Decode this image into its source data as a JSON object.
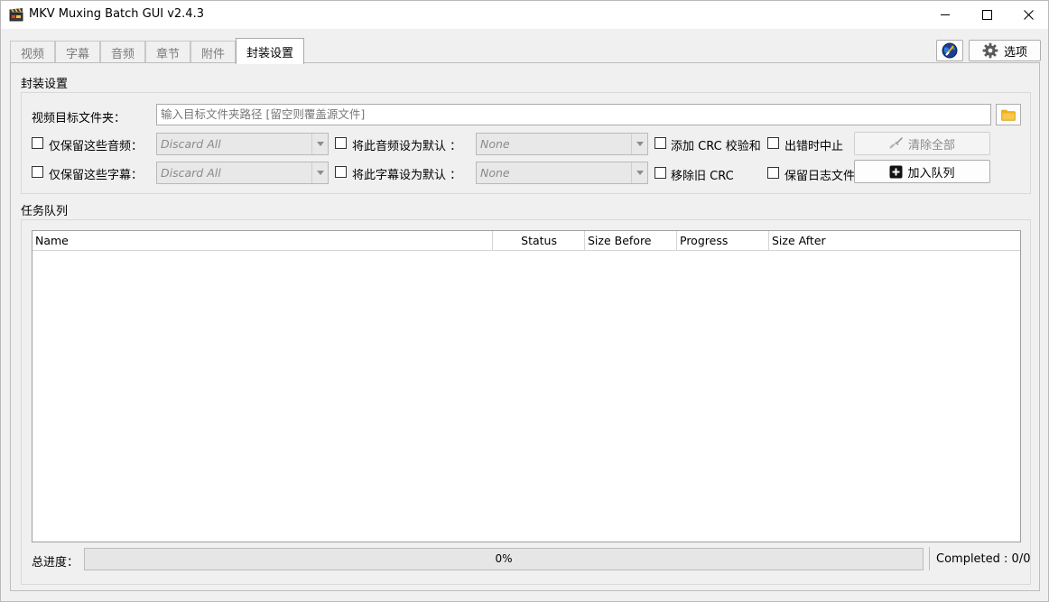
{
  "window": {
    "title": "MKV Muxing Batch GUI v2.4.3"
  },
  "tabs": [
    {
      "label": "视频"
    },
    {
      "label": "字幕"
    },
    {
      "label": "音频"
    },
    {
      "label": "章节"
    },
    {
      "label": "附件"
    },
    {
      "label": "封装设置"
    }
  ],
  "active_tab": 5,
  "toolbar": {
    "options_label": "选项"
  },
  "mux_settings": {
    "section_title": "封装设置",
    "output_folder": {
      "label": "视频目标文件夹：",
      "value": "",
      "placeholder": "输入目标文件夹路径 [留空则覆盖源文件]"
    },
    "keep_audio": {
      "label": "仅保留这些音频：",
      "checked": false,
      "combo_value": "Discard All"
    },
    "keep_subs": {
      "label": "仅保留这些字幕：",
      "checked": false,
      "combo_value": "Discard All"
    },
    "default_audio": {
      "label": "将此音频设为默认 ：",
      "checked": false,
      "combo_value": "None"
    },
    "default_subs": {
      "label": "将此字幕设为默认 ：",
      "checked": false,
      "combo_value": "None"
    },
    "add_crc": {
      "label": "添加 CRC 校验和",
      "checked": false
    },
    "remove_crc": {
      "label": "移除旧 CRC",
      "checked": false
    },
    "abort_on_error": {
      "label": "出错时中止",
      "checked": false
    },
    "keep_log": {
      "label": "保留日志文件",
      "checked": false
    },
    "clear_all_label": "清除全部",
    "add_to_queue_label": "加入队列"
  },
  "queue": {
    "section_title": "任务队列",
    "columns": [
      "Name",
      "Status",
      "Size Before",
      "Progress",
      "Size After"
    ],
    "rows": []
  },
  "footer": {
    "total_progress_label": "总进度：",
    "progress_value": 0,
    "progress_text": "0%",
    "completed_text": "Completed : 0/0"
  },
  "colors": {
    "window_bg": "#f0f0f0",
    "progress_fill": "#06b025",
    "folder_icon": "#f2b01e"
  }
}
